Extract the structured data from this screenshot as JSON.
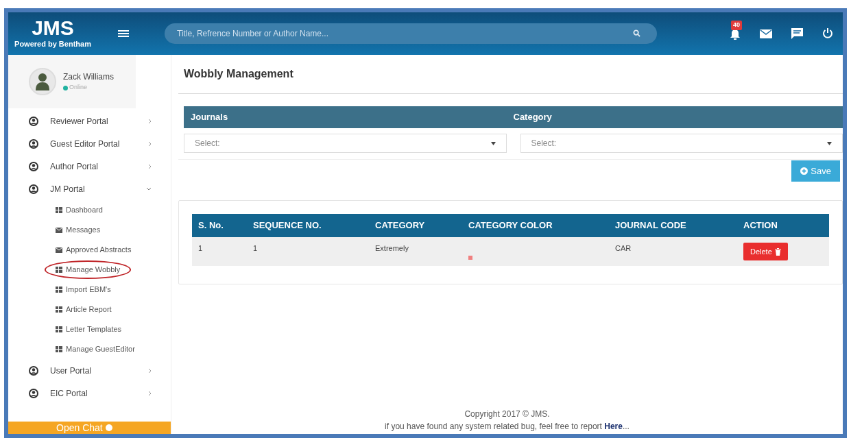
{
  "header": {
    "logo": "JMS",
    "tagline": "Powered by Bentham",
    "search_placeholder": "Title, Refrence Number or Author Name...",
    "notification_count": "40"
  },
  "user": {
    "name": "Zack Williams",
    "status": "Online"
  },
  "sidebar": {
    "items": [
      {
        "label": "Reviewer Portal",
        "expanded": false
      },
      {
        "label": "Guest Editor Portal",
        "expanded": false
      },
      {
        "label": "Author Portal",
        "expanded": false
      },
      {
        "label": "JM Portal",
        "expanded": true,
        "children": [
          {
            "label": "Dashboard",
            "kind": "grid",
            "circled": false
          },
          {
            "label": "Messages",
            "kind": "mail",
            "circled": false
          },
          {
            "label": "Approved Abstracts",
            "kind": "mail",
            "circled": false
          },
          {
            "label": "Manage Wobbly",
            "kind": "grid",
            "circled": true
          },
          {
            "label": "Import EBM's",
            "kind": "grid",
            "circled": false
          },
          {
            "label": "Article Report",
            "kind": "grid",
            "circled": false
          },
          {
            "label": "Letter Templates",
            "kind": "grid",
            "circled": false
          },
          {
            "label": "Manage GuestEditor",
            "kind": "grid",
            "circled": false
          }
        ]
      },
      {
        "label": "User Portal",
        "expanded": false
      },
      {
        "label": "EIC Portal",
        "expanded": false
      }
    ],
    "chat": "Open Chat"
  },
  "page_title": "Wobbly Management",
  "filters": [
    {
      "label": "Journals",
      "placeholder": "Select:"
    },
    {
      "label": "Category",
      "placeholder": "Select:"
    }
  ],
  "save_button": "Save",
  "table": {
    "columns": [
      "S. No.",
      "SEQUENCE NO.",
      "CATEGORY",
      "CATEGORY COLOR",
      "JOURNAL CODE",
      "ACTION"
    ],
    "rows": [
      {
        "s_no": "1",
        "sequence_no": "1",
        "category": "Extremely",
        "color": "#f08080",
        "journal_code": "CAR",
        "action": "Delete"
      }
    ]
  },
  "footer": {
    "copyright": "Copyright 2017 © JMS.",
    "bug_text": "if you have found any system related bug, feel free to report",
    "link": "Here",
    "suffix": "..."
  }
}
